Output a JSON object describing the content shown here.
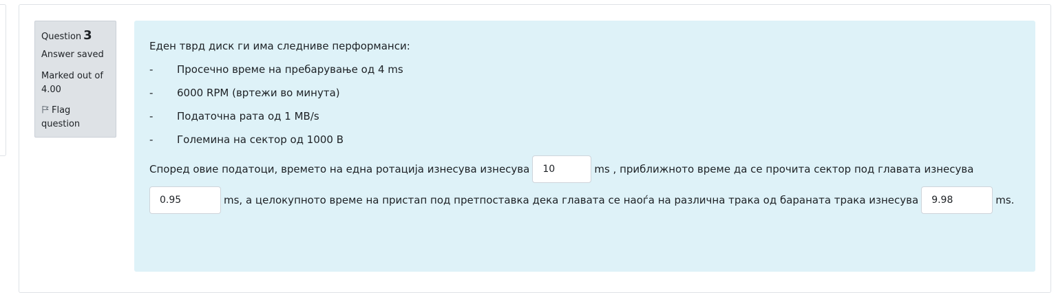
{
  "info": {
    "question_label": "Question",
    "question_number": "3",
    "state": "Answer saved",
    "grade": "Marked out of 4.00",
    "flag_label": "Flag question"
  },
  "question": {
    "intro": "Еден тврд диск ги има следниве перформанси:",
    "bullets": [
      {
        "dash": "-",
        "text": "Просечно време на пребарување од 4 ms"
      },
      {
        "dash": "-",
        "text": "6000 RPM (вртежи во минута)"
      },
      {
        "dash": "-",
        "text": "Податочна рата од 1 MB/s"
      },
      {
        "dash": "-",
        "text": "Големина на сектор од 1000 B"
      }
    ],
    "text_1": "Според овие податоци, времето на една ротација изнесува изнесува",
    "answer_1": "10",
    "text_2": "ms , приближното време  да се прочита сектор под главата изнесува",
    "answer_2": "0.95",
    "text_3": "ms, а целокупното време на пристап под претпоставка дека главата се наоѓа на различна трака од бараната трака изнесува",
    "answer_3": "9.98",
    "text_4": "ms."
  },
  "colors": {
    "info_bg": "#dee2e6",
    "content_bg": "#def2f8",
    "text": "#1d2125"
  }
}
